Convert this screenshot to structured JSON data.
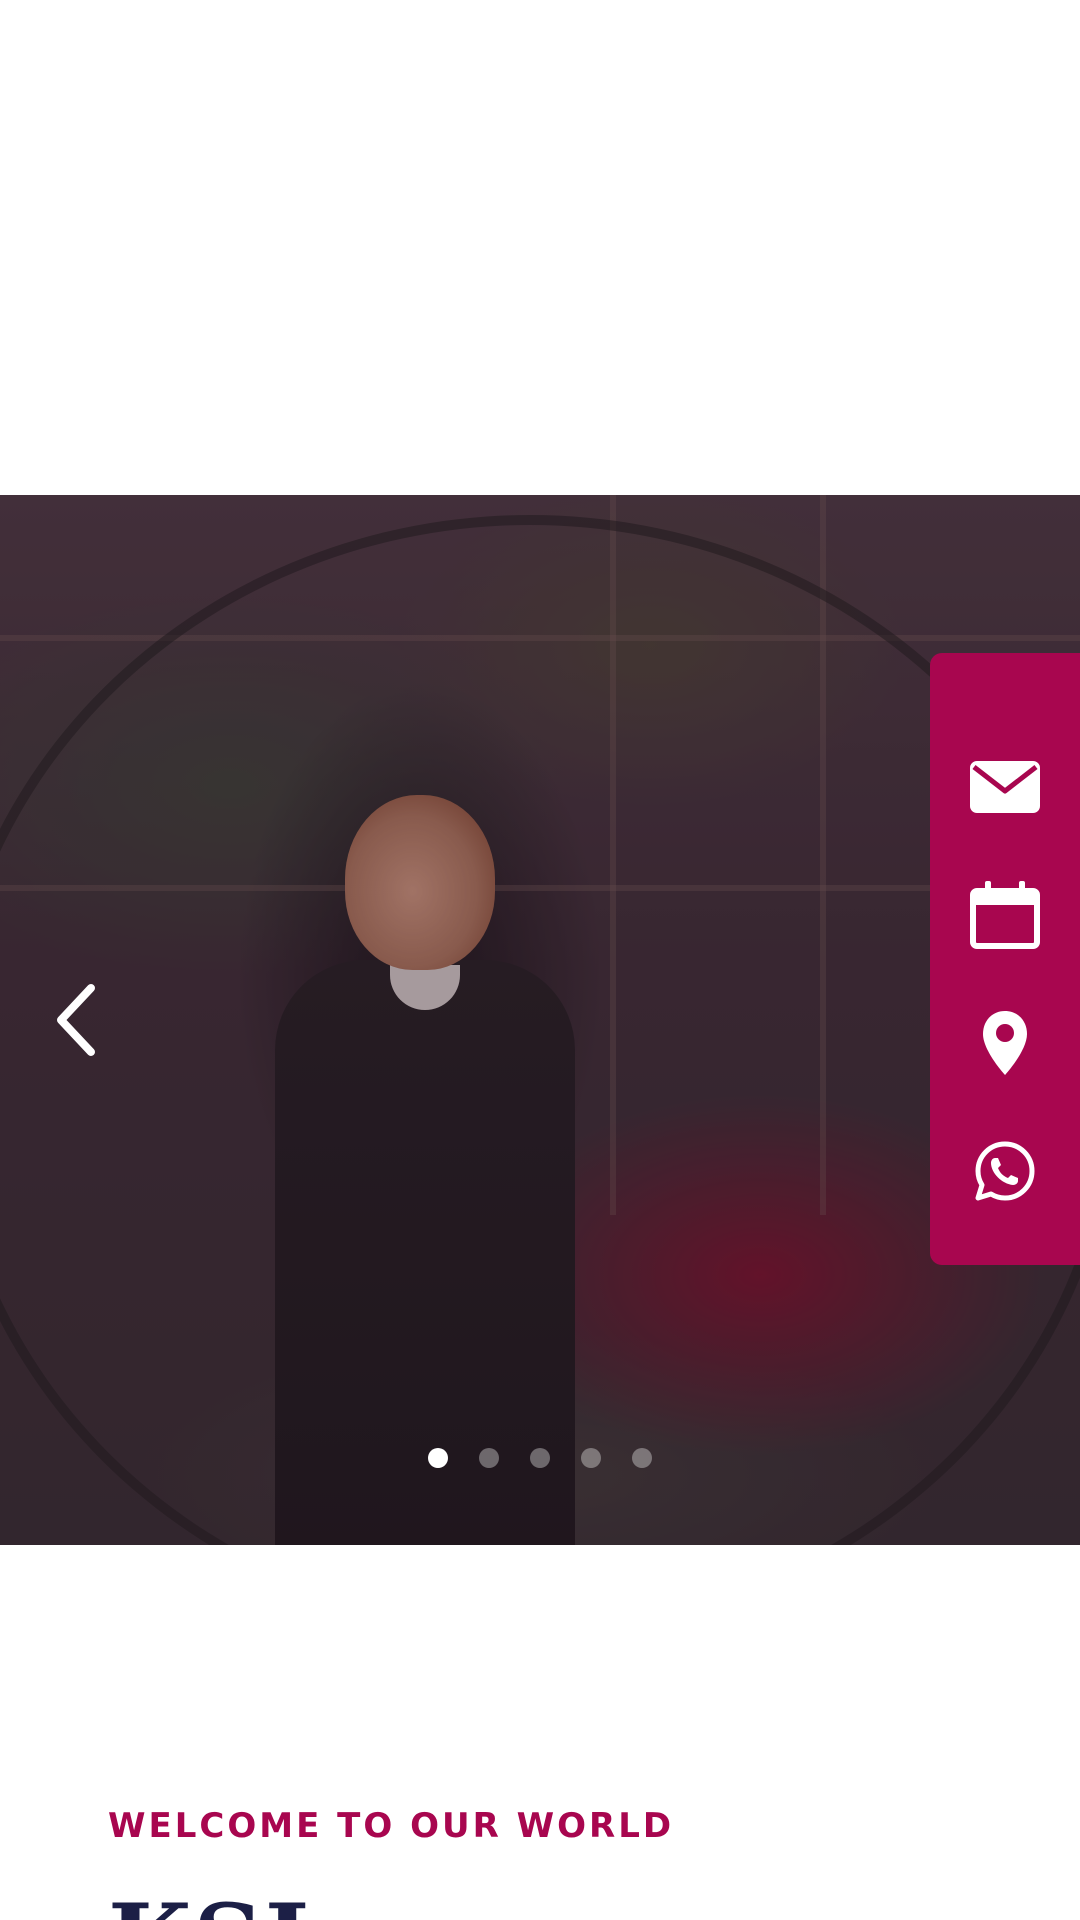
{
  "colors": {
    "accent": "#a8064f",
    "heading": "#1c1f46",
    "white": "#ffffff"
  },
  "hero": {
    "prev_icon": "chevron-left-icon",
    "slide_count": 5,
    "active_slide": 1
  },
  "side_panel": {
    "items": [
      {
        "icon": "envelope-icon"
      },
      {
        "icon": "calendar-icon"
      },
      {
        "icon": "map-pin-icon"
      },
      {
        "icon": "whatsapp-icon"
      }
    ]
  },
  "welcome": {
    "eyebrow": "WELCOME TO OUR WORLD",
    "heading": "KSL"
  }
}
